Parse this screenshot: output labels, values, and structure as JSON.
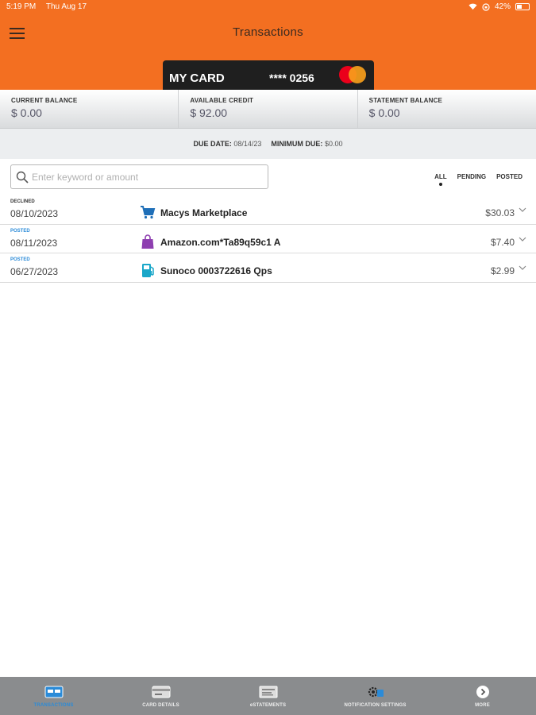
{
  "status_bar": {
    "time": "5:19 PM",
    "date": "Thu Aug 17",
    "battery": "42%",
    "battery_level": 0.42
  },
  "header": {
    "title": "Transactions"
  },
  "card": {
    "name": "MY CARD",
    "number": "**** 0256",
    "network_icon": "mastercard-icon"
  },
  "balances": [
    {
      "label": "CURRENT BALANCE",
      "value": "$ 0.00"
    },
    {
      "label": "AVAILABLE CREDIT",
      "value": "$ 92.00"
    },
    {
      "label": "STATEMENT BALANCE",
      "value": "$ 0.00"
    }
  ],
  "due": {
    "due_date_label": "DUE DATE:",
    "due_date": "08/14/23",
    "min_due_label": "MINIMUM DUE:",
    "min_due": "$0.00"
  },
  "search": {
    "placeholder": "Enter keyword or amount"
  },
  "filters": [
    "ALL",
    "PENDING",
    "POSTED"
  ],
  "transactions": [
    {
      "status": "DECLINED",
      "date": "08/10/2023",
      "merchant": "Macys Marketplace",
      "amount": "$30.03",
      "icon": "shopping-cart-icon"
    },
    {
      "status": "POSTED",
      "date": "08/11/2023",
      "merchant": "Amazon.com*Ta89q59c1 A",
      "amount": "$7.40",
      "icon": "shopping-bag-icon"
    },
    {
      "status": "POSTED",
      "date": "06/27/2023",
      "merchant": "Sunoco 0003722616 Qps",
      "amount": "$2.99",
      "icon": "gas-pump-icon"
    }
  ],
  "tabs": [
    {
      "label": "TRANSACTIONS",
      "icon": "card-icon"
    },
    {
      "label": "CARD DETAILS",
      "icon": "card-details-icon"
    },
    {
      "label": "eSTATEMENTS",
      "icon": "statement-icon"
    },
    {
      "label": "NOTIFICATION SETTINGS",
      "icon": "gear-notification-icon"
    },
    {
      "label": "MORE",
      "icon": "chevron-right-circle-icon"
    }
  ],
  "colors": {
    "brand": "#f36f21",
    "accent": "#2b8bd8",
    "tabbar": "#8a8c8e"
  }
}
